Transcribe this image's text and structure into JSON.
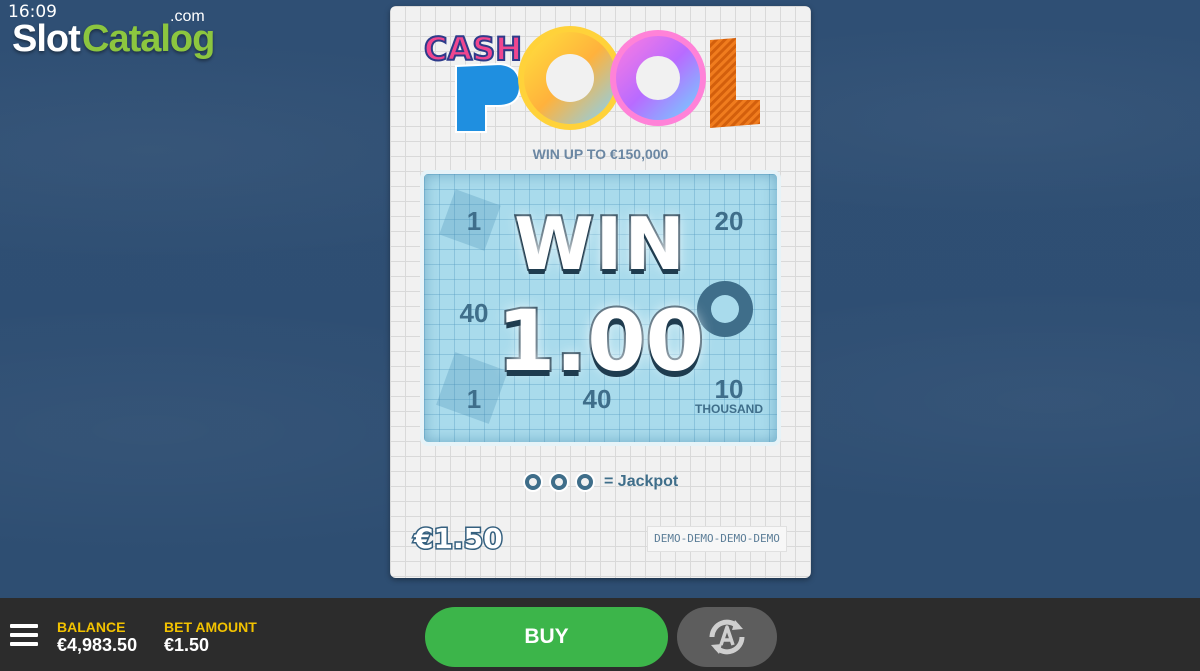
{
  "status_bar": {
    "time": "16:09"
  },
  "watermark": {
    "slot": "Slot",
    "catalog": "Catalog",
    "com": ".com"
  },
  "game": {
    "logo": {
      "word1": "CASH",
      "word2": "POOL"
    },
    "win_up_to": "WIN UP TO €150,000",
    "cells": [
      {
        "value": "1",
        "sub": ""
      },
      {
        "value": "20",
        "sub": ""
      },
      {
        "value": "40",
        "sub": ""
      },
      {
        "value": "1",
        "sub": ""
      },
      {
        "value": "40",
        "sub": ""
      },
      {
        "value": "10",
        "sub": "THOUSAND"
      }
    ],
    "win_label": "WIN",
    "win_amount": "1.00",
    "jackpot_label": "= Jackpot",
    "ticket_price": "€1.50",
    "demo_label": "DEMO-DEMO-DEMO-DEMO"
  },
  "bottom_bar": {
    "balance_label": "BALANCE",
    "balance_value": "€4,983.50",
    "bet_label": "BET AMOUNT",
    "bet_value": "€1.50",
    "buy_label": "BUY",
    "auto_icon": "autoplay-icon",
    "menu_icon": "hamburger-menu-icon"
  },
  "colors": {
    "background": "#2f4f74",
    "buy_button": "#3cb54a",
    "label_yellow": "#f2c200",
    "pool_water": "#a9dbec"
  }
}
